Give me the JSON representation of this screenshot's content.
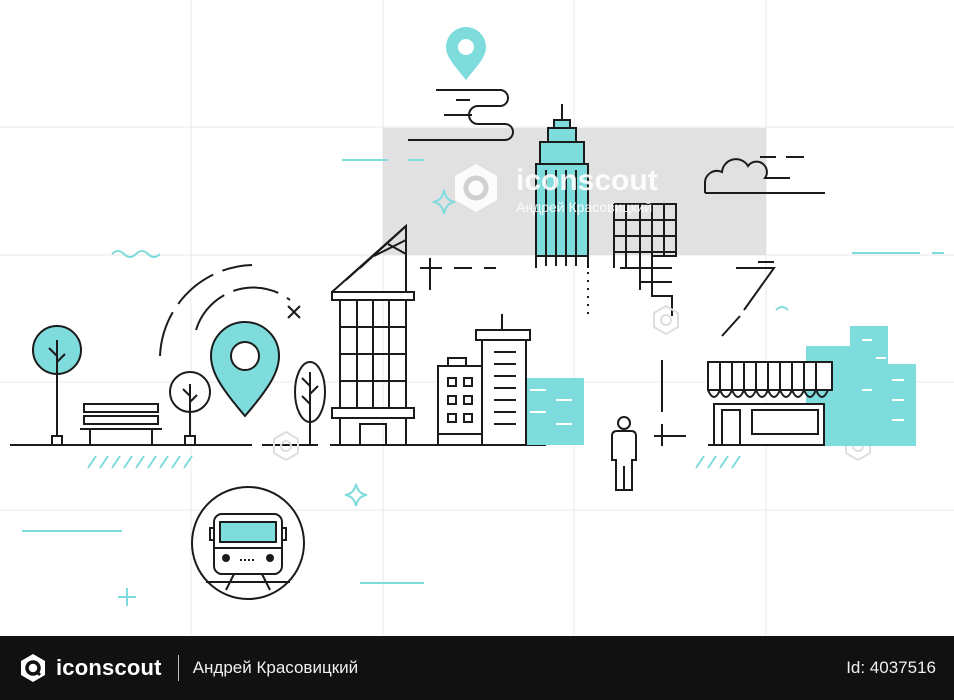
{
  "colors": {
    "accent": "#7fdcdc",
    "line": "#1b1b1b",
    "grid": "#e6e6e6",
    "watermark": "#d9d9d9",
    "footer_bg": "#111111"
  },
  "watermark": {
    "brand": "iconscout",
    "author": "Андрей Красовицкий"
  },
  "footer": {
    "brand": "iconscout",
    "author": "Андрей Красовицкий",
    "asset_id": "Id: 4037516"
  },
  "icons": [
    "location-pin-icon",
    "iconscout-logo-icon",
    "bus-icon",
    "person-icon",
    "tree-icon",
    "bench-icon",
    "cloud-icon",
    "sparkle-icon"
  ]
}
